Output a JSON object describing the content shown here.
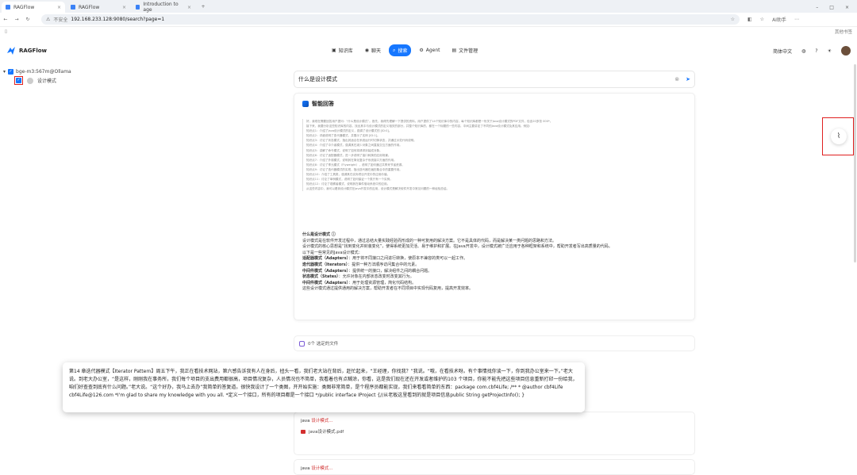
{
  "browser": {
    "tabs": [
      {
        "label": "RAGFlow",
        "active": true
      },
      {
        "label": "RAGFlow",
        "active": false
      },
      {
        "label": "Introduction to age",
        "active": false
      }
    ],
    "new_tab": "+",
    "insecure_label": "不安全",
    "url": "192.168.233.128:9080/search?page=1",
    "ai_label": "AI助手",
    "bookmarks_right": "其他书签"
  },
  "app": {
    "brand": "RAGFlow",
    "nav": [
      {
        "label": "知识库",
        "icon": "book-icon",
        "active": false
      },
      {
        "label": "聊天",
        "icon": "chat-icon",
        "active": false
      },
      {
        "label": "搜索",
        "icon": "search-icon",
        "active": true
      },
      {
        "label": "Agent",
        "icon": "agent-icon",
        "active": false
      },
      {
        "label": "文件管理",
        "icon": "folder-icon",
        "active": false
      }
    ],
    "language": "简体中文",
    "accent": "#1677ff"
  },
  "sidebar": {
    "kb_name": "bge-m3:567m@Ollama",
    "doc_name": "设计模式"
  },
  "search": {
    "query": "什么是设计模式"
  },
  "answer": {
    "title": "智能回答",
    "thinking": [
      "好，我现在需要回答用户提问：“什么是设计模式”。首先，我得先理解一下提供的资料。用户提供了14个知识库中的内容，每个知识库都是一份关于Java设计模式的PDF文件，包含20多张 000*。",
      "接下来，我要分析这些知识库的内容，找出其中与设计模式的定义相关的部分，并整个知识库的，都在一个标题的一些内容，中间主要讲定了不同的Java设计模式及其应用。例如：",
      "知识点1：介绍了Java设计模式的定义，强调了设计模式的 [ID:0]。",
      "知识点2：详细说明了迭代器模式，并展示了实例 [ID:1]。",
      "知识点3：讨论了状态模式，指出其适合在系统运行时切换状态，并通过示范代码说明。",
      "知识点4：介绍了中介者模式，强调其在减少对象之间直接交互方面的作用。",
      "知识点5：讲解了命令模式，说明了如何将请求封装成对象。",
      "知识点6：讨论了适配器模式，进一步说明了接口转换的应用场景。",
      "知识点7：介绍了外观模式，说明其在简化复杂子系统接口方面的作用。",
      "知识点8：讨论了享元模式（Flyweight），说明了如何通过共享来节省资源。",
      "知识点9：讨论了迭代器模式的实现，指出迭代器在遍历集合中的重要作用。",
      "知识点10：介绍了工具类，强调其在实际项目开发中的应用价值。",
      "知识点11：讨论了单例模式，说明了如何保证一个类只有一个实例。",
      "知识点12：讨论了观察者模式，说明其在事件驱动系统中的应用。",
      "从这些内容中，我可以看到设计模式在Java开发中的应用，设计模式是解决软件开发中常见问题的一种经验总结。"
    ],
    "heading": "什么是设计模式",
    "paragraphs": [
      "设计模式是在软件开发过程中，通过总结大量实践经验而形成的一种可复用的解决方案。它不是具体的代码，而是解决某一类问题的思路和方法。",
      "设计模式的核心思想是“找到变化并封装变化”，使得系统更加灵活、易于维护和扩展。在Java开发中，设计模式被广泛应用于各种框架和系统中，帮助开发者写出高质量的代码。",
      "以下是一些常见的Java设计模式："
    ],
    "items": [
      {
        "name": "适配器模式（Adapters）",
        "desc": "：用于将不同接口之间进行转换，使原本不兼容的类可以一起工作。"
      },
      {
        "name": "迭代器模式（Iterators）",
        "desc": "：提供一种方法顺序访问集合中的元素。"
      },
      {
        "name": "中间件模式（Adapters）",
        "desc": "：提供统一的接口，解决组件之间的耦合问题。"
      },
      {
        "name": "状态模式（States）",
        "desc": "：允许对象在内部状态改变时改变其行为。"
      },
      {
        "name": "中间件模式（Adapters）",
        "desc": "：用于处理资源管理，简化代码结构。"
      }
    ],
    "closing": "这些设计模式通过提供通用的解决方案，帮助开发者在不同项目中实现代码复用，提高开发效率。"
  },
  "files": {
    "label": "0个 选定的文件"
  },
  "results": [
    {
      "prefix": "java",
      "highlight": "设计模式...",
      "file": "java设计模式.pdf"
    },
    {
      "prefix": "java",
      "highlight": "设计模式...",
      "file": ""
    }
  ],
  "tooltip": {
    "text": "第14 章迭代器模式【Iterator Pattern】周五下午，我正在看技术网站，第六感告诉我有人在身后，扭头一看，我们老大站在背后，赶忙起来，“王经理，你找我？”我说。“哦，在看技术呀。有个事情找你谈一下，你到我办公室来一下。”老大说。到老大办公室，“是这样，刚刚我在事务所，我们每个项目的支出费用都很高，项目情况复杂，人员情况也不简单，我看着也有点糊涂，你看，这是我们现在还在开发或者维护的103 个项目，你能不能先把这些项目信息重新打印一份给我，咱们好查查到底有什么问题。”老大说。“这个好办，我马上去办”我简单的答复道。很快我设计了一个类图，开开始实施：类图非常简单，是个程序员都能实现，我们来看看简单的东西：package com.cbf4Life; /** * @author cbf4Life cbf4Life@126.com *I'm glad to share my knowledge with you all. *定义一个接口，所有的项目都是一个接口 */public interface IProject {//从老板这里看到的就是项目信息public String getProjectInfo(); }"
  }
}
